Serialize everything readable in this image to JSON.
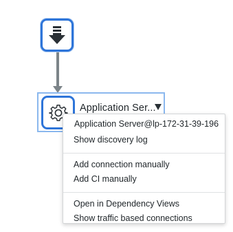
{
  "colors": {
    "node_border": "#2e75d9",
    "selection_outline": "#8bb8ee",
    "connector": "#7c8489",
    "text": "#1f2529"
  },
  "entry_node": {
    "icon": "download-arrow-icon"
  },
  "ci_node": {
    "icon": "gear-icon",
    "label": "Application Ser...",
    "dropdown_icon": "caret-down-icon"
  },
  "context_menu": {
    "header": "Application Server@lp-172-31-39-196",
    "groups": [
      [
        "Show discovery log"
      ],
      [
        "Add connection manually",
        "Add CI manually"
      ],
      [
        "Open in Dependency Views",
        "Show traffic based connections"
      ]
    ]
  }
}
